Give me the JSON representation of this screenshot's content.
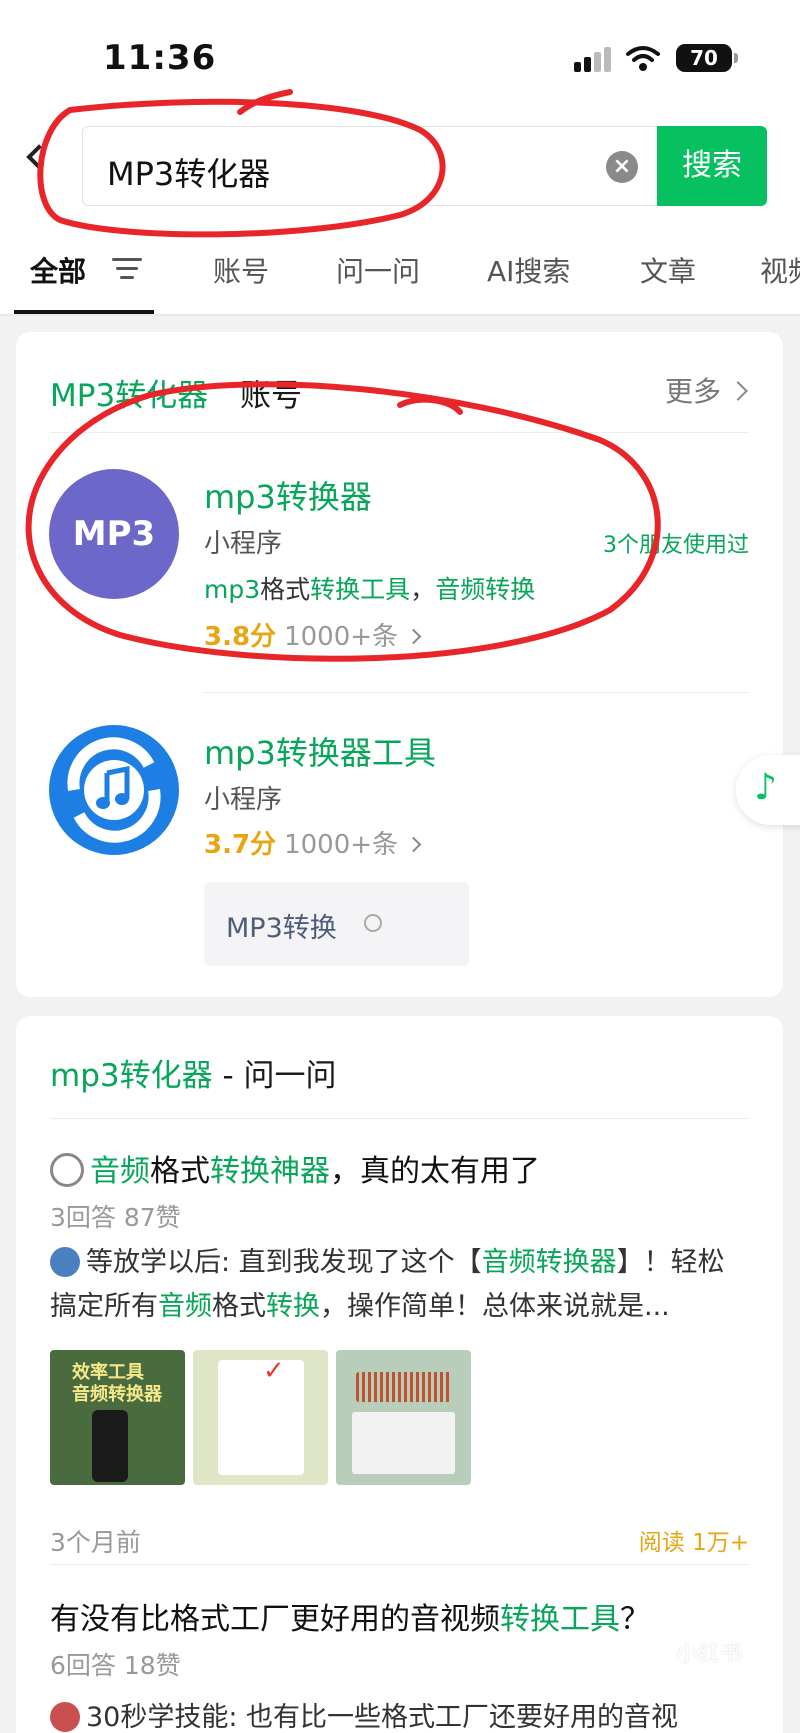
{
  "status": {
    "time": "11:36",
    "battery": "70"
  },
  "search": {
    "query": "MP3转化器",
    "button": "搜索"
  },
  "tabs": [
    {
      "label": "全部"
    },
    {
      "label": "账号"
    },
    {
      "label": "问一问"
    },
    {
      "label": "AI搜索"
    },
    {
      "label": "文章"
    },
    {
      "label": "视频"
    }
  ],
  "account_section": {
    "heading_keyword": "MP3转化器",
    "heading_label": "账号",
    "more": "更多",
    "items": [
      {
        "avatar_text": "MP3",
        "title": "mp3转换器",
        "type": "小程序",
        "friends": "3个朋友使用过",
        "desc_a": "mp3",
        "desc_b": "格式",
        "desc_c": "转换工具",
        "desc_d": "，",
        "desc_e": "音频转换",
        "score": "3.8分",
        "count": "1000+条"
      },
      {
        "avatar_icon": "music-note-icon",
        "title": "mp3转换器工具",
        "type": "小程序",
        "score": "3.7分",
        "count": "1000+条",
        "sublink": "MP3转换"
      }
    ]
  },
  "ask_section": {
    "heading_keyword": "mp3转化器",
    "heading_label": " - 问一问",
    "questions": [
      {
        "title_a": "音频",
        "title_b": "格式",
        "title_c": "转换神器",
        "title_d": "，真的太有用了",
        "meta": "3回答 87赞",
        "snippet_a": "等放学以后: 直到我发现了这个【",
        "snippet_b": "音频转换器",
        "snippet_c": "】！轻松搞定所有",
        "snippet_d": "音频",
        "snippet_e": "格式",
        "snippet_f": "转换",
        "snippet_g": "，操作简单！总体来说就是...",
        "thumb1_text": "效率工具\n音频转换器",
        "time": "3个月前",
        "reads": "阅读 1万+"
      },
      {
        "title_a": "有没有比格式工厂更好用的音视频",
        "title_b": "转换工具",
        "title_c": "？",
        "meta": "6回答 18赞",
        "snippet": "30秒学技能: 也有比一些格式工厂还要好用的音视"
      }
    ]
  },
  "watermark": "小红书",
  "colors": {
    "accent": "#07c160",
    "link_green": "#07a65a",
    "rating": "#e7a512",
    "annotation_red": "#e8262a"
  }
}
